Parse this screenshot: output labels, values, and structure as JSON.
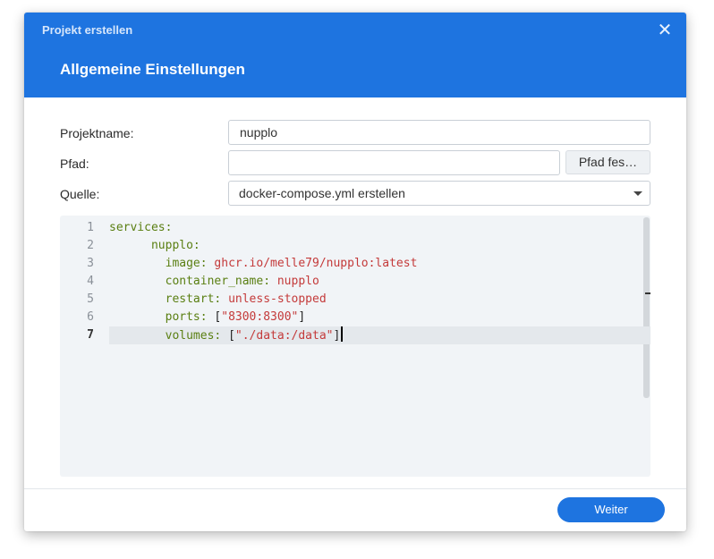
{
  "dialog": {
    "title": "Projekt erstellen",
    "close_icon": "close-icon",
    "heading": "Allgemeine Einstellungen"
  },
  "form": {
    "project_name_label": "Projektname:",
    "project_name_value": "nupplo",
    "path_label": "Pfad:",
    "path_value": "",
    "path_button": "Pfad fes…",
    "source_label": "Quelle:",
    "source_selected": "docker-compose.yml erstellen",
    "source_caret_icon": "caret-down-icon"
  },
  "editor": {
    "active_line": 7,
    "lines": [
      {
        "num": "1",
        "segments": [
          {
            "t": "services:",
            "c": "k"
          }
        ]
      },
      {
        "num": "2",
        "segments": [
          {
            "t": "      ",
            "c": "p"
          },
          {
            "t": "nupplo:",
            "c": "k"
          }
        ]
      },
      {
        "num": "3",
        "segments": [
          {
            "t": "        ",
            "c": "p"
          },
          {
            "t": "image:",
            "c": "k"
          },
          {
            "t": " ",
            "c": "p"
          },
          {
            "t": "ghcr.io/melle79/nupplo:latest",
            "c": "v"
          }
        ]
      },
      {
        "num": "4",
        "segments": [
          {
            "t": "        ",
            "c": "p"
          },
          {
            "t": "container_name:",
            "c": "k"
          },
          {
            "t": " ",
            "c": "p"
          },
          {
            "t": "nupplo",
            "c": "v"
          }
        ]
      },
      {
        "num": "5",
        "segments": [
          {
            "t": "        ",
            "c": "p"
          },
          {
            "t": "restart:",
            "c": "k"
          },
          {
            "t": " ",
            "c": "p"
          },
          {
            "t": "unless-stopped",
            "c": "v"
          }
        ]
      },
      {
        "num": "6",
        "segments": [
          {
            "t": "        ",
            "c": "p"
          },
          {
            "t": "ports:",
            "c": "k"
          },
          {
            "t": " [",
            "c": "p"
          },
          {
            "t": "\"8300:8300\"",
            "c": "v"
          },
          {
            "t": "]",
            "c": "p"
          }
        ]
      },
      {
        "num": "7",
        "segments": [
          {
            "t": "        ",
            "c": "p"
          },
          {
            "t": "volumes:",
            "c": "k"
          },
          {
            "t": " [",
            "c": "p"
          },
          {
            "t": "\"./data:/data\"",
            "c": "v"
          },
          {
            "t": "]",
            "c": "p"
          }
        ]
      }
    ]
  },
  "footer": {
    "next_button": "Weiter"
  },
  "colors": {
    "header_bg": "#1e74e0",
    "key": "#5a7f12",
    "value": "#c43a3a",
    "editor_bg": "#f1f4f7"
  }
}
